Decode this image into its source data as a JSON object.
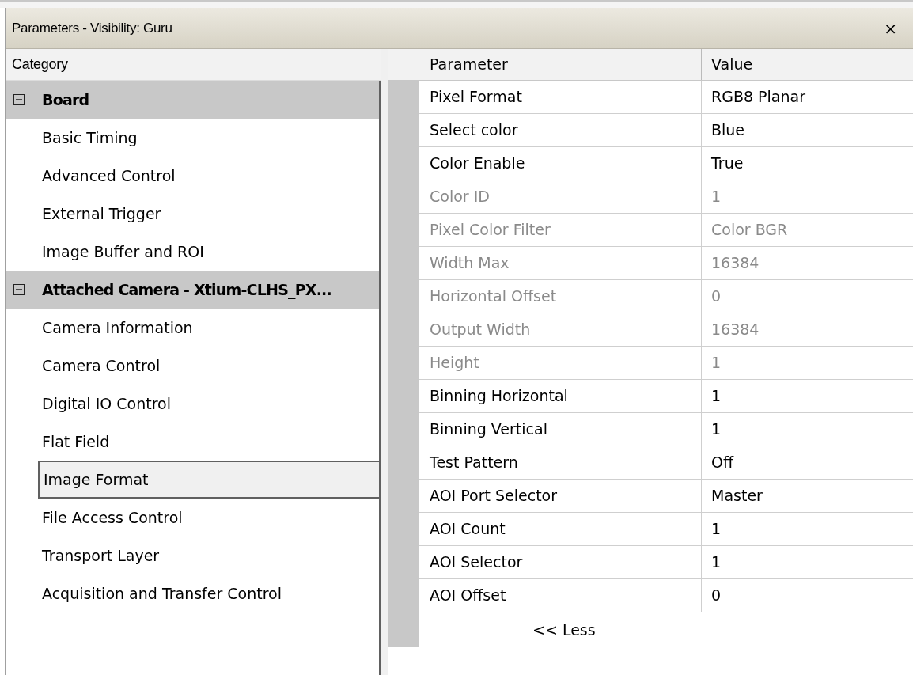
{
  "window": {
    "title": "Parameters - Visibility: Guru",
    "close": "×"
  },
  "category_panel": {
    "header": "Category",
    "groups": [
      {
        "label": "Board",
        "expanded": true,
        "children": [
          {
            "label": "Basic Timing",
            "selected": false
          },
          {
            "label": "Advanced Control",
            "selected": false
          },
          {
            "label": "External Trigger",
            "selected": false
          },
          {
            "label": "Image Buffer and ROI",
            "selected": false
          }
        ]
      },
      {
        "label": "Attached Camera - Xtium-CLHS_PX...",
        "expanded": true,
        "children": [
          {
            "label": "Camera Information",
            "selected": false
          },
          {
            "label": "Camera Control",
            "selected": false
          },
          {
            "label": "Digital IO Control",
            "selected": false
          },
          {
            "label": "Flat Field",
            "selected": false
          },
          {
            "label": "Image Format",
            "selected": true
          },
          {
            "label": "File Access Control",
            "selected": false
          },
          {
            "label": "Transport Layer",
            "selected": false
          },
          {
            "label": "Acquisition and Transfer Control",
            "selected": false
          }
        ]
      }
    ]
  },
  "parameter_table": {
    "columns": [
      "Parameter",
      "Value"
    ],
    "rows": [
      {
        "parameter": "Pixel Format",
        "value": "RGB8 Planar",
        "disabled": false
      },
      {
        "parameter": "Select color",
        "value": "Blue",
        "disabled": false
      },
      {
        "parameter": "Color Enable",
        "value": "True",
        "disabled": false
      },
      {
        "parameter": "Color ID",
        "value": "1",
        "disabled": true
      },
      {
        "parameter": "Pixel Color Filter",
        "value": "Color BGR",
        "disabled": true
      },
      {
        "parameter": "Width Max",
        "value": "16384",
        "disabled": true
      },
      {
        "parameter": "Horizontal Offset",
        "value": "0",
        "disabled": true
      },
      {
        "parameter": "Output Width",
        "value": "16384",
        "disabled": true
      },
      {
        "parameter": "Height",
        "value": "1",
        "disabled": true
      },
      {
        "parameter": "Binning Horizontal",
        "value": "1",
        "disabled": false
      },
      {
        "parameter": "Binning Vertical",
        "value": "1",
        "disabled": false
      },
      {
        "parameter": "Test Pattern",
        "value": "Off",
        "disabled": false
      },
      {
        "parameter": "AOI Port Selector",
        "value": "Master",
        "disabled": false
      },
      {
        "parameter": "AOI Count",
        "value": "1",
        "disabled": false
      },
      {
        "parameter": "AOI Selector",
        "value": "1",
        "disabled": false
      },
      {
        "parameter": "AOI Offset",
        "value": "0",
        "disabled": false
      }
    ],
    "less_button": "<< Less"
  }
}
